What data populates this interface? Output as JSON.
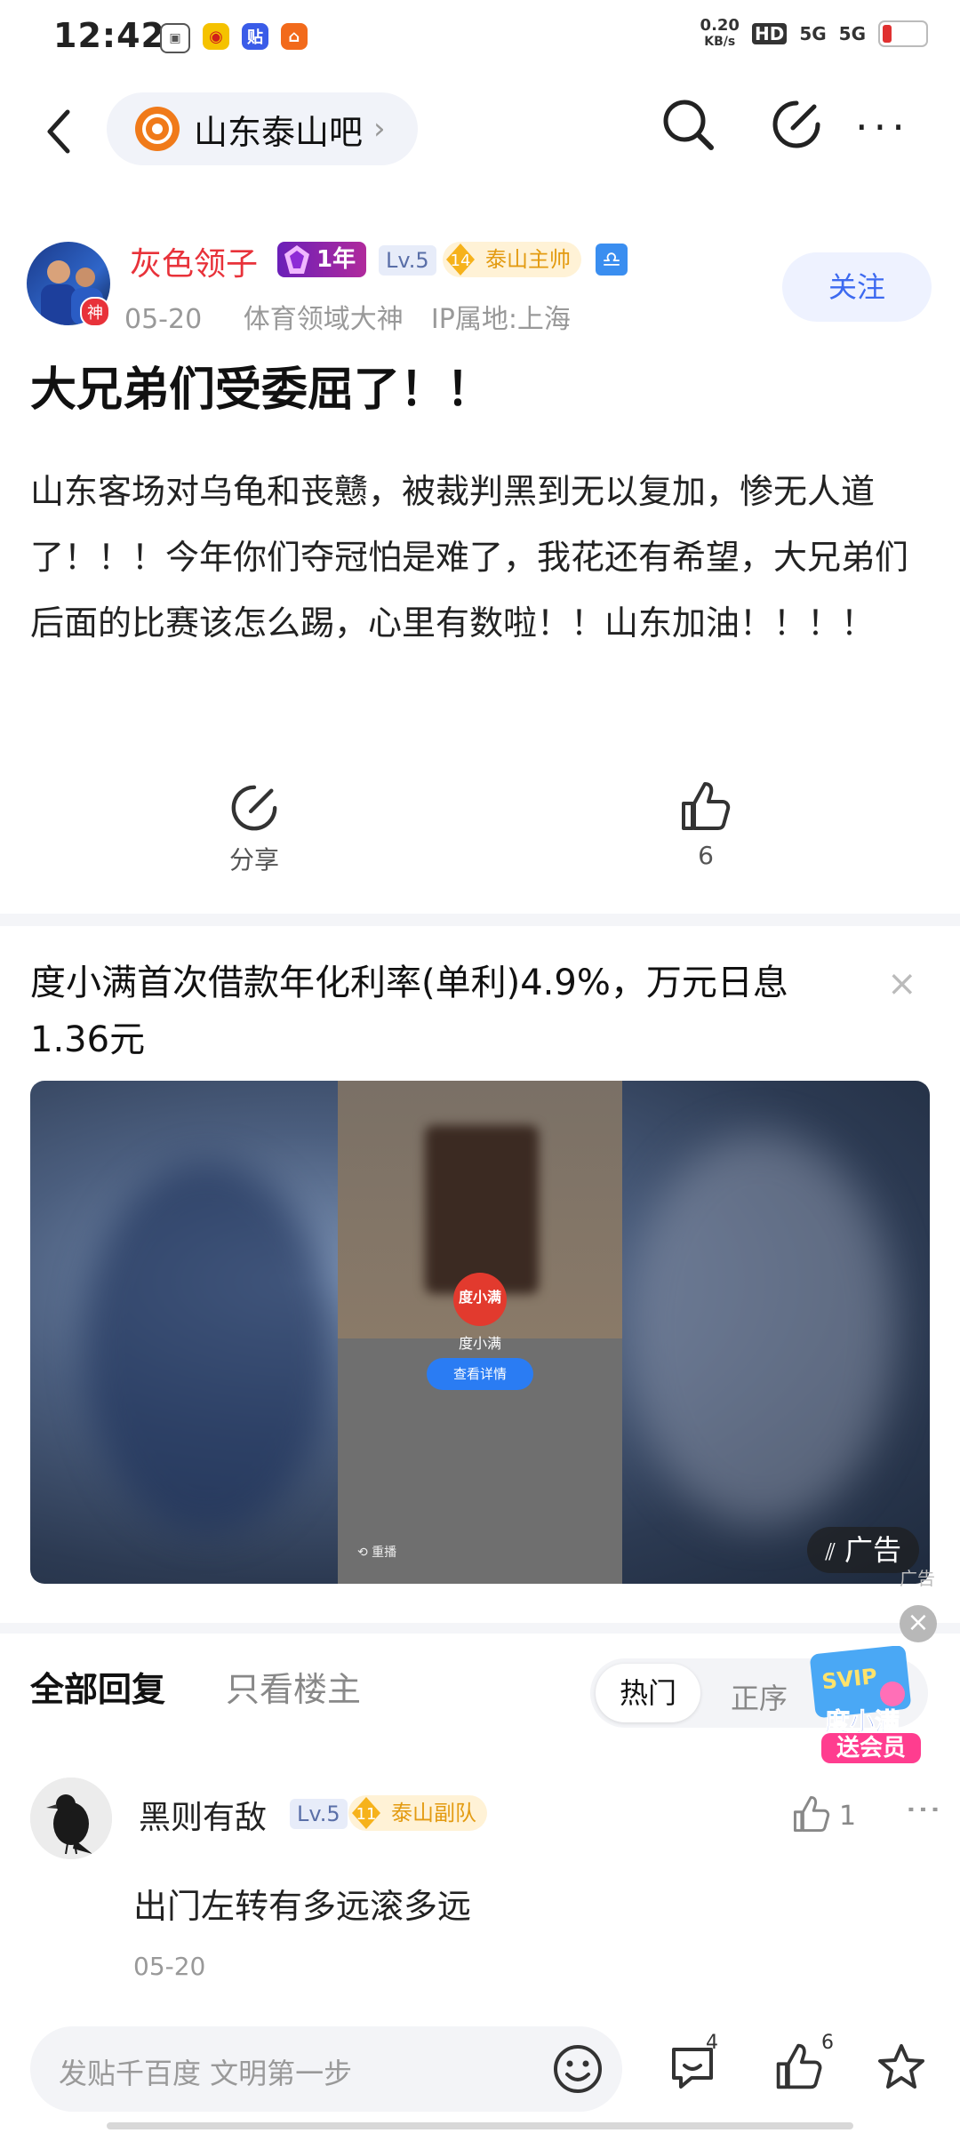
{
  "status_bar": {
    "time": "12:42",
    "net_speed_value": "0.20",
    "net_speed_unit": "KB/s",
    "hd": "HD",
    "signal1": "5G",
    "signal2": "5G",
    "battery_color": "#e03030"
  },
  "nav": {
    "forum_name": "山东泰山吧",
    "forum_chevron": "›"
  },
  "author": {
    "name": "灰色领子",
    "avatar_badge": "神",
    "year_badge": "1年",
    "level": "Lv.5",
    "title_level": "14",
    "title": "泰山主帅",
    "zodiac": "♎",
    "date": "05-20",
    "role": "体育领域大神",
    "ip": "IP属地:上海",
    "follow_label": "关注"
  },
  "post": {
    "title": "大兄弟们受委屈了！！",
    "body": "山东客场对乌龟和丧戆，被裁判黑到无以复加，惨无人道了！！！今年你们夺冠怕是难了，我花还有希望，大兄弟们后面的比赛该怎么踢，心里有数啦！！山东加油！！！！",
    "share_label": "分享",
    "like_count": "6"
  },
  "ad": {
    "title": "度小满首次借款年化利率(单利)4.9%，万元日息1.36元",
    "close": "×",
    "logo_text": "度小满",
    "brand": "度小满",
    "cta": "查看详情",
    "replay": "⟲ 重播",
    "tag": "广告",
    "small_tag": "广告"
  },
  "replies_header": {
    "tab_all": "全部回复",
    "tab_op": "只看楼主",
    "sort_hot": "热门",
    "sort_seq": "正序",
    "promo_close": "×",
    "promo_svip": "SVIP",
    "promo_line1": "度小满",
    "promo_line2": "送会员"
  },
  "reply": {
    "name": "黑则有敌",
    "level": "Lv.5",
    "title_level": "11",
    "title": "泰山副队",
    "like_count": "1",
    "more": "⋮",
    "text": "出门左转有多远滚多远",
    "date": "05-20"
  },
  "bottom_bar": {
    "placeholder": "发贴千百度 文明第一步",
    "comment_count": "4",
    "like_count": "6"
  }
}
